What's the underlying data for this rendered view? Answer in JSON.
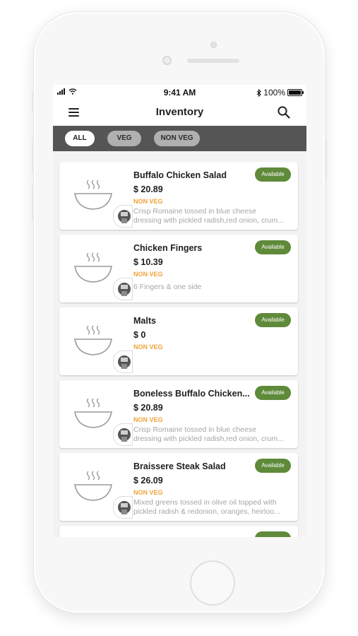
{
  "status_bar": {
    "time": "9:41 AM",
    "battery": "100%"
  },
  "nav": {
    "title": "Inventory",
    "menu_icon": "hamburger-menu-icon",
    "search_icon": "search-icon"
  },
  "filters": [
    {
      "label": "ALL",
      "active": true
    },
    {
      "label": "VEG",
      "active": false
    },
    {
      "label": "NON VEG",
      "active": false
    }
  ],
  "colors": {
    "available": "#5f8a3a",
    "non_veg": "#f0a23a",
    "filter_bar": "#555555"
  },
  "items": [
    {
      "name": "Buffalo Chicken Salad",
      "price": "$ 20.89",
      "type": "NON VEG",
      "status": "Available",
      "description": [
        "Crisp Romaine tossed in blue cheese",
        "dressing with pickled radish,red onion, crum..."
      ]
    },
    {
      "name": "Chicken Fingers",
      "price": "$ 10.39",
      "type": "NON VEG",
      "status": "Available",
      "description": [
        "6 Fingers & one side",
        ""
      ]
    },
    {
      "name": "Malts",
      "price": "$ 0",
      "type": "NON VEG",
      "status": "Available",
      "description": [
        "",
        ""
      ]
    },
    {
      "name": "Boneless Buffalo Chicken...",
      "price": "$ 20.89",
      "type": "NON VEG",
      "status": "Available",
      "description": [
        "Crisp Romaine tossed in blue cheese",
        "dressing with pickled radish,red onion, crum..."
      ]
    },
    {
      "name": "Braissere Steak Salad",
      "price": "$ 26.09",
      "type": "NON VEG",
      "status": "Available",
      "description": [
        "Mixed greens tossed in olive oil topped with",
        "pickled radish & redonion, oranges, heirloo..."
      ]
    }
  ]
}
